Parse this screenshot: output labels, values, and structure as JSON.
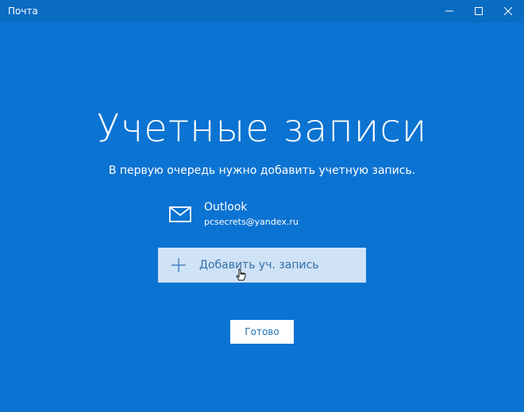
{
  "window": {
    "title": "Почта",
    "controls": {
      "minimize_icon": "minimize-icon",
      "maximize_icon": "maximize-icon",
      "close_icon": "close-icon"
    }
  },
  "main": {
    "heading": "Учетные записи",
    "subheading": "В первую очередь нужно добавить учетную запись.",
    "account": {
      "name": "Outlook",
      "email": "pcsecrets@yandex.ru",
      "icon": "mail-icon"
    },
    "add_account": {
      "label": "Добавить уч. запись",
      "icon": "plus-icon"
    },
    "done_button": "Готово"
  },
  "colors": {
    "background": "#0b73d2",
    "titlebar": "#0a6bc3",
    "text": "#ffffff",
    "add_button": "#cfe2f6"
  }
}
